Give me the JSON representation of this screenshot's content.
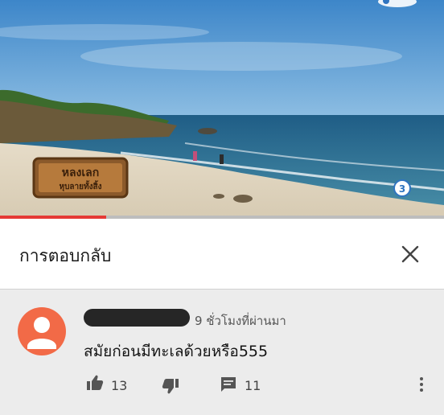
{
  "video": {
    "show_title_logo": "หลงเลก หุบลายทั้งสิ้ง",
    "progress_fraction": 0.24,
    "channel_logo": "ch3-logo"
  },
  "header": {
    "title": "การตอบกลับ",
    "close_icon": "close-icon"
  },
  "comment": {
    "author": "",
    "time": "9 ชั่วโมงที่ผ่านมา",
    "text": "สมัยก่อนมีทะเลด้วยหรือ555",
    "likes": "13",
    "replies": "11"
  },
  "colors": {
    "avatar": "#f26a47",
    "progress": "#e53935",
    "sea": "#2f6c8f"
  }
}
